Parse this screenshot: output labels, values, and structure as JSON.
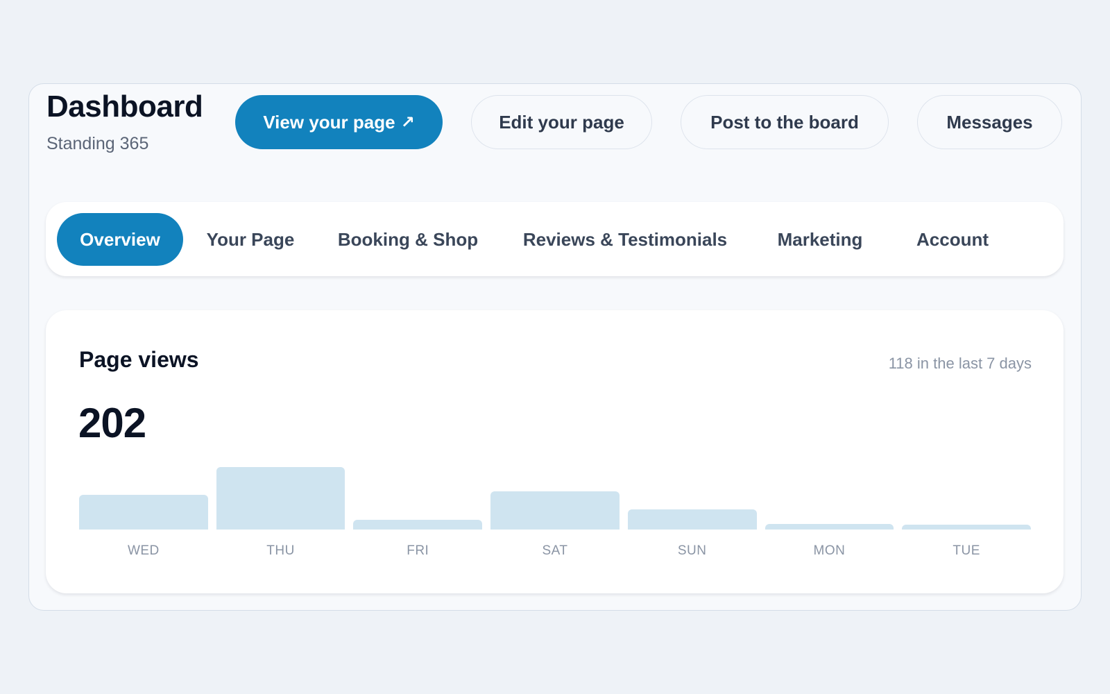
{
  "header": {
    "title": "Dashboard",
    "subtitle": "Standing 365"
  },
  "actions": {
    "view_page": "View your page",
    "view_page_arrow": "↗",
    "edit_page": "Edit your page",
    "post_board": "Post to the board",
    "messages": "Messages"
  },
  "tabs": [
    {
      "label": "Overview",
      "active": true
    },
    {
      "label": "Your Page",
      "active": false
    },
    {
      "label": "Booking & Shop",
      "active": false
    },
    {
      "label": "Reviews & Testimonials",
      "active": false
    },
    {
      "label": "Marketing",
      "active": false
    },
    {
      "label": "Account",
      "active": false
    }
  ],
  "page_views": {
    "title": "Page views",
    "summary": "118 in the last 7 days",
    "total": "202"
  },
  "colors": {
    "accent": "#1282bd",
    "bar": "#cfe4f0"
  },
  "chart_data": {
    "type": "bar",
    "categories": [
      "WED",
      "THU",
      "FRI",
      "SAT",
      "SUN",
      "MON",
      "TUE"
    ],
    "values": [
      56,
      101,
      16,
      62,
      33,
      9,
      8
    ],
    "ylim": [
      0,
      112
    ],
    "grid": false,
    "legend": "none"
  }
}
